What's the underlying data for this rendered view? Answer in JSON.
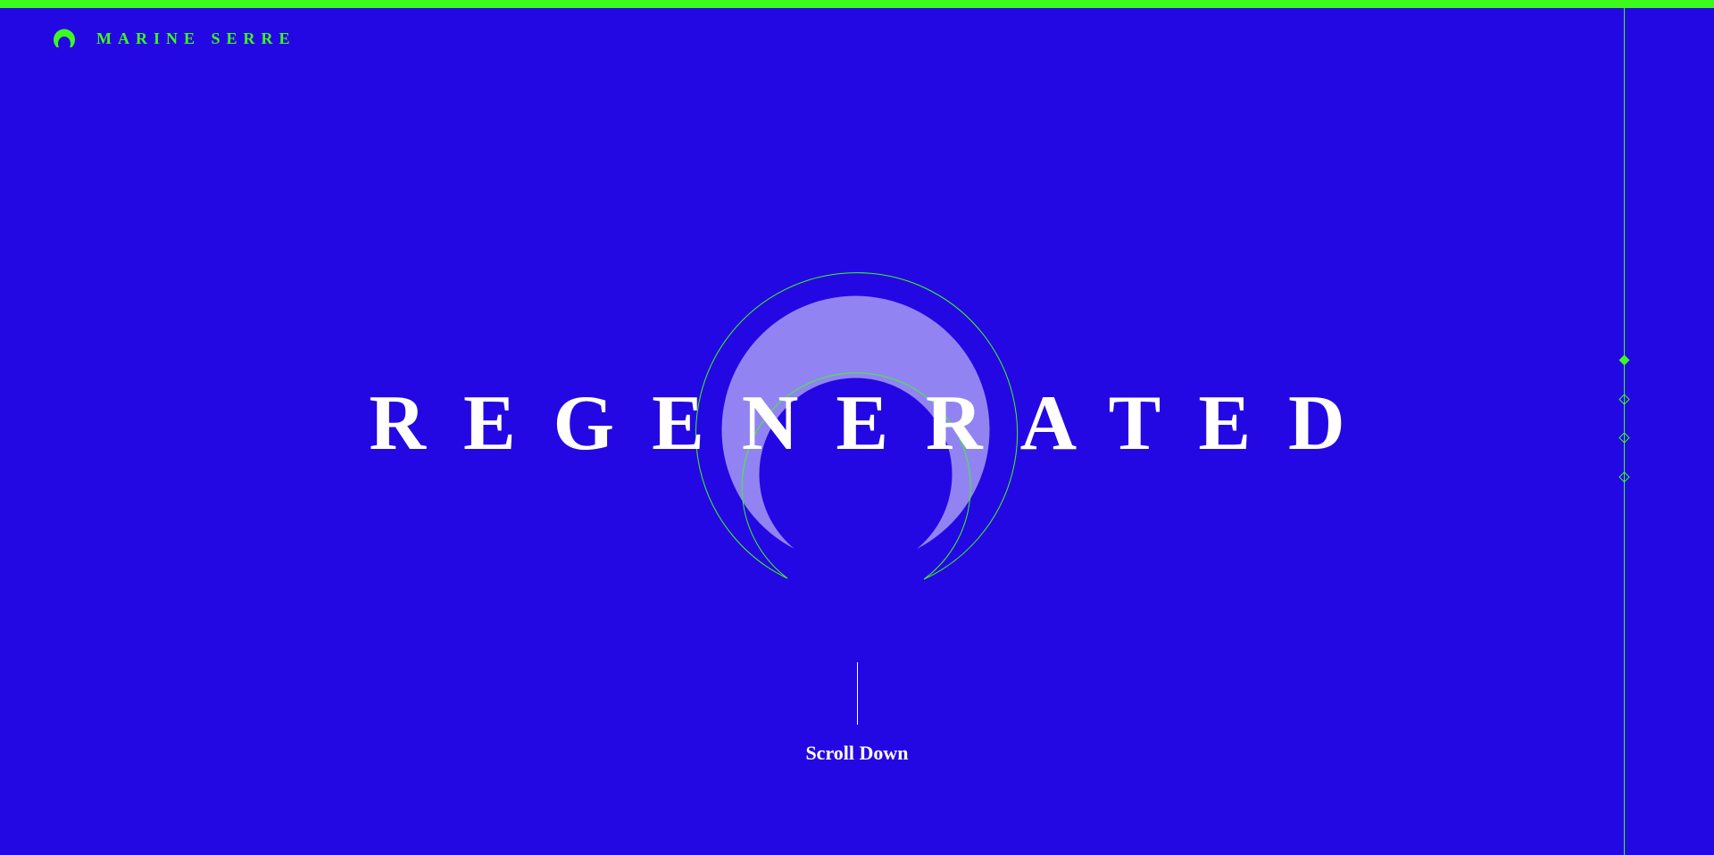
{
  "brand": {
    "name": "MARINE SERRE",
    "logo": "crescent-moon-logo",
    "accent_color": "#3df91f"
  },
  "hero": {
    "title": "REGENERATED",
    "emblem": "crescent-moon-emblem",
    "background_color": "#2408e3",
    "emblem_fill_color": "#9184f2"
  },
  "scroll": {
    "label": "Scroll Down"
  },
  "side_nav": {
    "items": [
      {
        "icon": "diamond-filled-icon",
        "active": true
      },
      {
        "icon": "diamond-outline-icon",
        "active": false
      },
      {
        "icon": "diamond-outline-icon",
        "active": false
      },
      {
        "icon": "diamond-outline-icon",
        "active": false
      }
    ]
  }
}
